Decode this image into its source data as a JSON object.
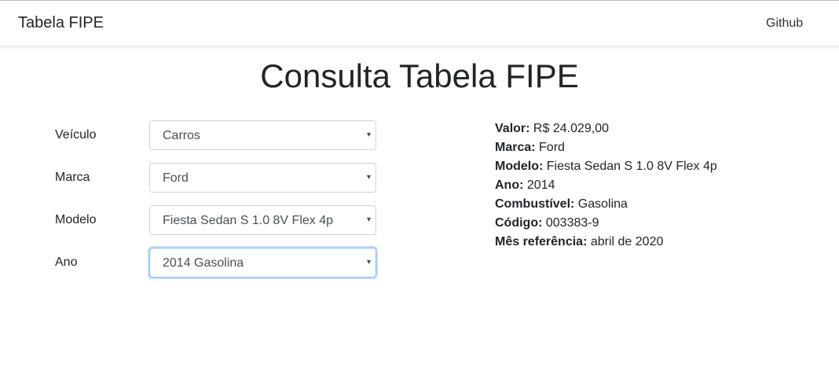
{
  "navbar": {
    "brand": "Tabela FIPE",
    "links": [
      {
        "label": "Github"
      }
    ]
  },
  "page": {
    "title": "Consulta Tabela FIPE"
  },
  "form": {
    "fields": [
      {
        "label": "Veículo",
        "value": "Carros"
      },
      {
        "label": "Marca",
        "value": "Ford"
      },
      {
        "label": "Modelo",
        "value": "Fiesta Sedan S 1.0 8V Flex 4p"
      },
      {
        "label": "Ano",
        "value": "2014 Gasolina",
        "focused": true
      }
    ]
  },
  "result": {
    "rows": [
      {
        "key": "Valor:",
        "value": "R$ 24.029,00"
      },
      {
        "key": "Marca:",
        "value": "Ford"
      },
      {
        "key": "Modelo:",
        "value": "Fiesta Sedan S 1.0 8V Flex 4p"
      },
      {
        "key": "Ano:",
        "value": "2014"
      },
      {
        "key": "Combustível:",
        "value": "Gasolina"
      },
      {
        "key": "Código:",
        "value": "003383-9"
      },
      {
        "key": "Mês referência:",
        "value": "abril de 2020"
      }
    ]
  },
  "icons": {
    "select_caret": "chevron-down-icon"
  }
}
